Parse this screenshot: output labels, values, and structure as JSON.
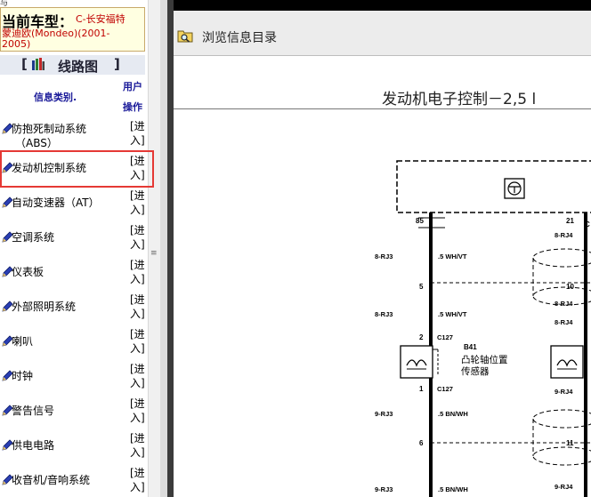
{
  "left_panel": {
    "top_cut_text": "与",
    "current_model": {
      "label": "当前车型：",
      "value_line1": "C-长安福特",
      "value_line2": "蒙迪欧(Mondeo)(2001-",
      "value_line3": "2005)"
    },
    "diagram_section": {
      "bracket_open": "[",
      "title": "线路图",
      "bracket_close": "]"
    },
    "table": {
      "col_category": "信息类别.",
      "col_op_line1": "用户",
      "col_op_line2": "操作",
      "rows": [
        {
          "label": "防抱死制动系统",
          "label2": "（ABS）",
          "enter1": "[进",
          "enter2": "入]"
        },
        {
          "label": "发动机控制系统",
          "enter1": "[进",
          "enter2": "入]"
        },
        {
          "label": "自动变速器（AT）",
          "enter1": "[进",
          "enter2": "入]"
        },
        {
          "label": "空调系统",
          "enter1": "[进",
          "enter2": "入]"
        },
        {
          "label": "仪表板",
          "enter1": "[进",
          "enter2": "入]"
        },
        {
          "label": "外部照明系统",
          "enter1": "[进",
          "enter2": "入]"
        },
        {
          "label": "喇叭",
          "enter1": "[进",
          "enter2": "入]"
        },
        {
          "label": "时钟",
          "enter1": "[进",
          "enter2": "入]"
        },
        {
          "label": "警告信号",
          "enter1": "[进",
          "enter2": "入]"
        },
        {
          "label": "供电电路",
          "enter1": "[进",
          "enter2": "入]"
        },
        {
          "label": "收音机/音响系统",
          "enter1": "[进",
          "enter2": "入]"
        }
      ]
    },
    "highlight_color": "#e53935",
    "scroll_glyph": "≡"
  },
  "right_panel": {
    "toolbar": {
      "browse_label": "浏览信息目录",
      "icon": "folder-search-icon"
    },
    "page_title": "发动机电子控制－2,5 l",
    "wiring": {
      "pin_85": "85",
      "pin_21": "21",
      "pin_5": "5",
      "pin_10": "10",
      "pin_2": "2",
      "pin_1": "1",
      "pin_6": "6",
      "pin_11": "11",
      "conn_8rj3_a": "8-RJ3",
      "conn_8rj3_b": "8-RJ3",
      "conn_8rj4_a": "8-RJ4",
      "conn_8rj4_b": "8-RJ4",
      "conn_8rj4_c": "8-RJ4",
      "conn_9rj3_a": "9-RJ3",
      "conn_9rj3_b": "9-RJ3",
      "conn_9rj4_a": "9-RJ4",
      "conn_9rj4_b": "9-RJ4",
      "wire_wh_vt_a": ".5 WH/VT",
      "wire_wh_vt_b": ".5 WH/VT",
      "wire_bn_wh_a": ".5 BN/WH",
      "wire_bn_wh_b": ".5 BN/WH",
      "c127_top": "C127",
      "c127_bottom": "C127",
      "sensor_id": "B41",
      "sensor_name_1": "凸轮轴位置",
      "sensor_name_2": "传感器",
      "edge_c": "C"
    }
  }
}
